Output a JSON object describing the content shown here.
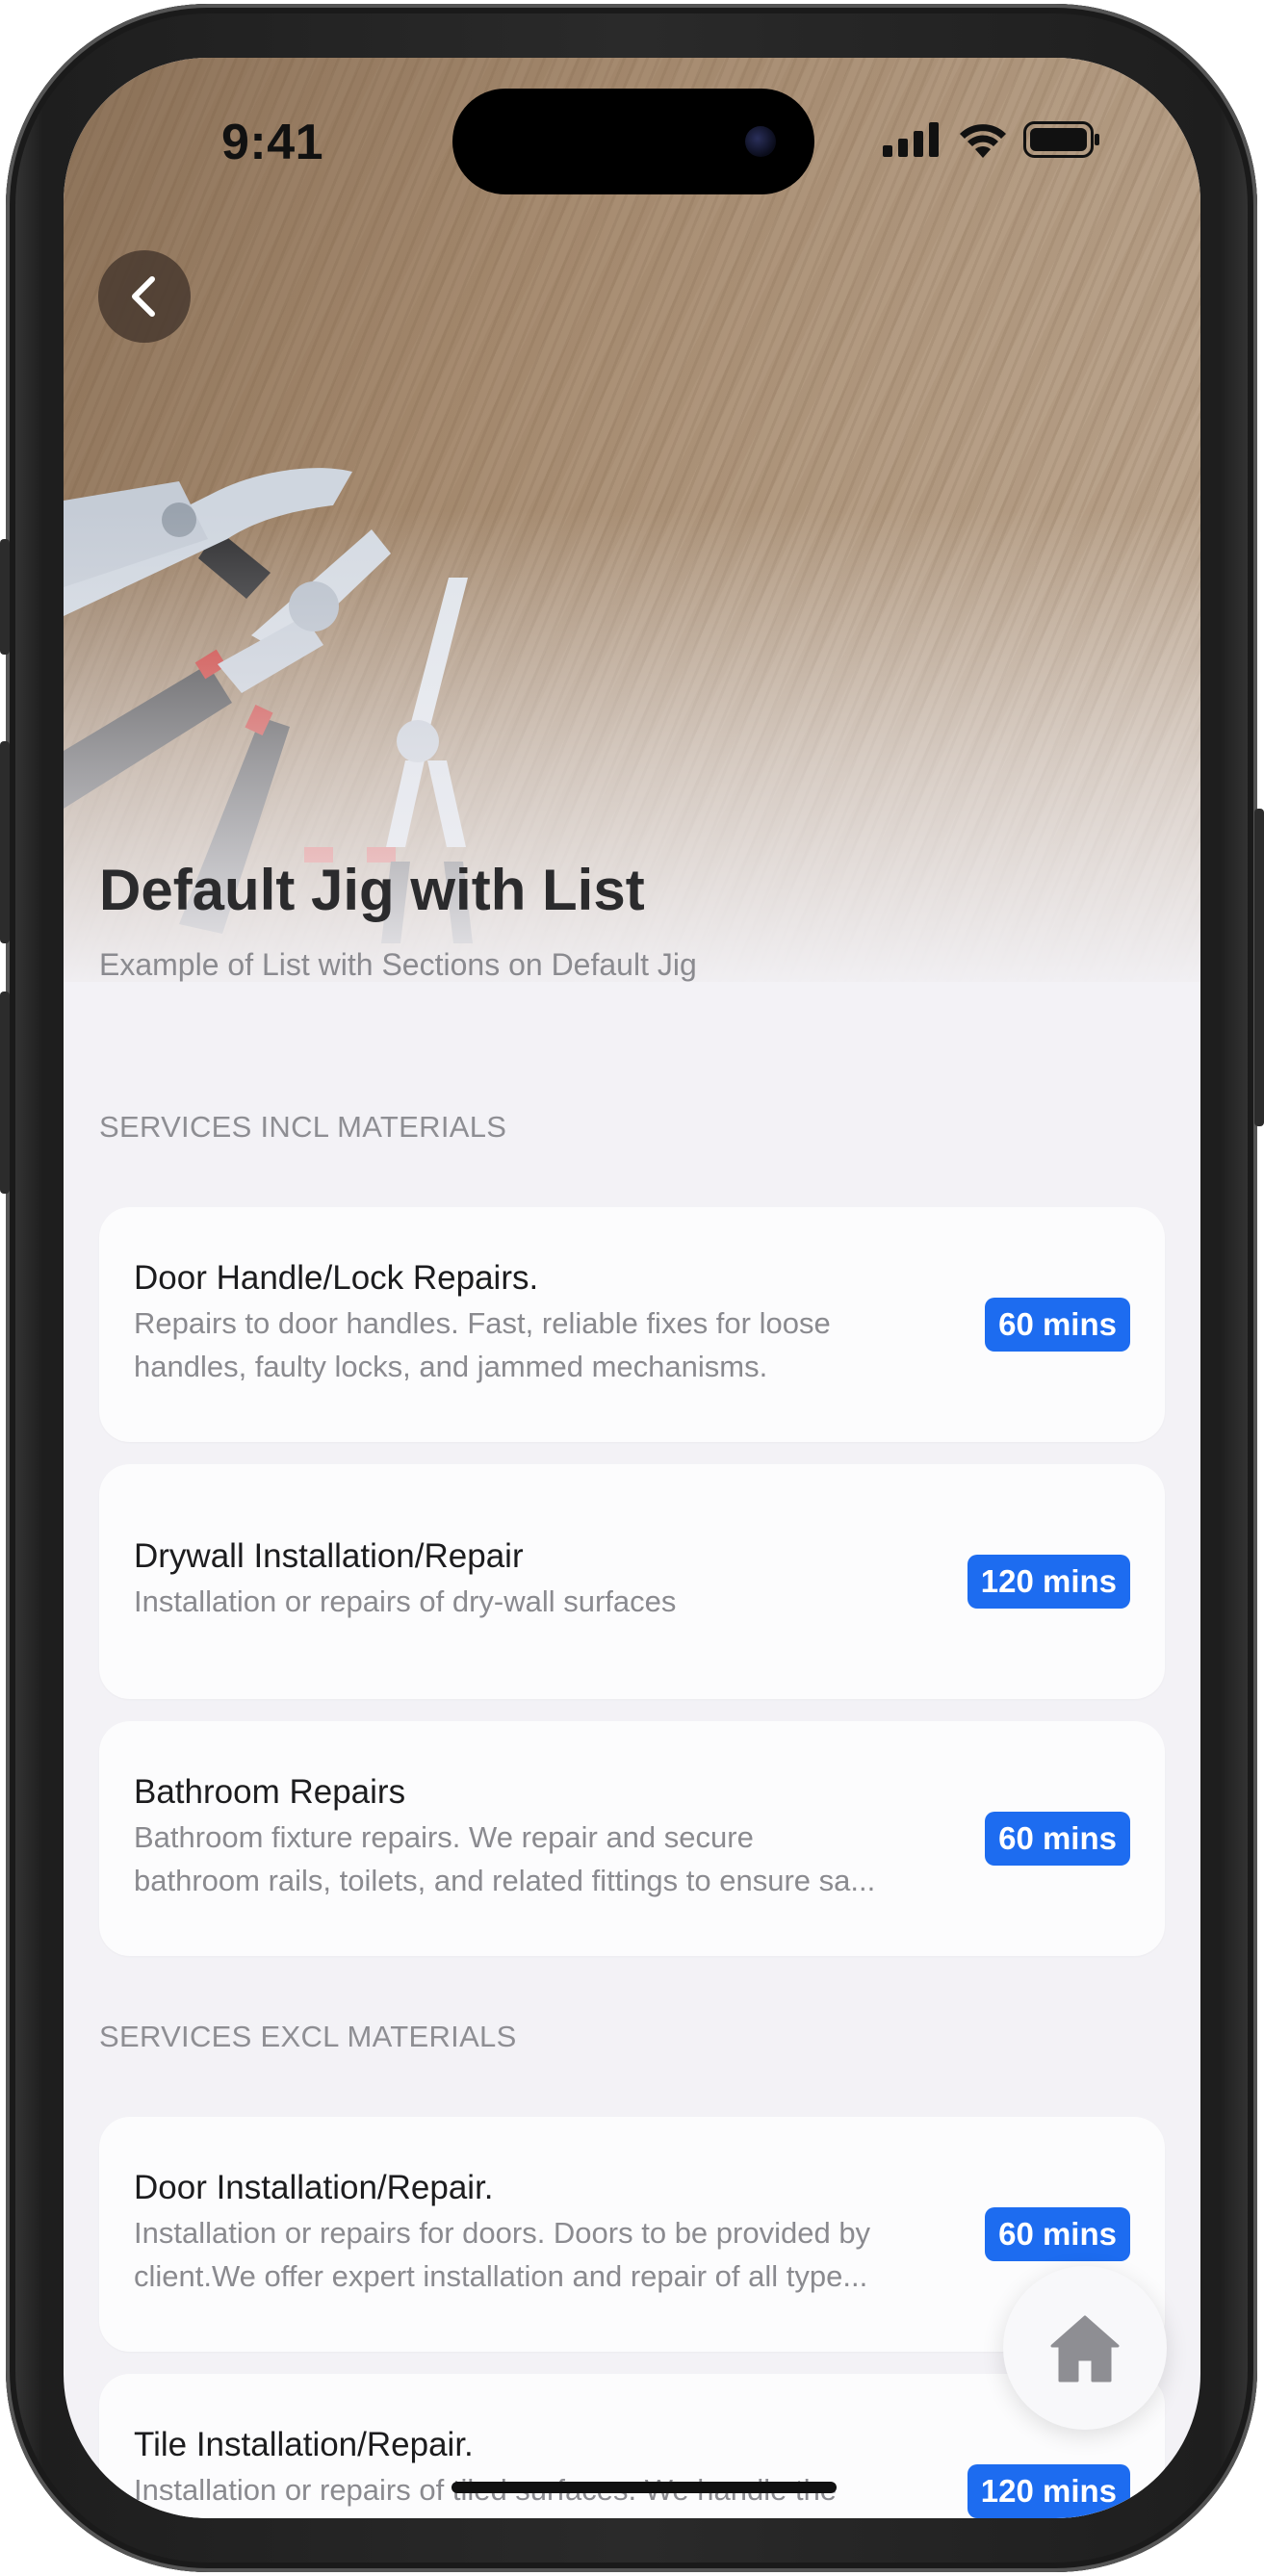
{
  "status_bar": {
    "time": "9:41",
    "icons": [
      "signal-icon",
      "wifi-icon",
      "battery-icon"
    ]
  },
  "navigation": {
    "back_icon": "chevron-left-icon"
  },
  "header": {
    "title": "Default Jig with List",
    "subtitle": "Example of List with Sections on Default Jig",
    "image": "pliers-on-wood-photo"
  },
  "sections": [
    {
      "title": "SERVICES INCL MATERIALS",
      "items": [
        {
          "title": "Door Handle/Lock Repairs.",
          "description": [
            "Repairs to door handles. Fast, reliable fixes for loose",
            "handles, faulty locks, and jammed mechanisms."
          ],
          "duration": "60 mins"
        },
        {
          "title": "Drywall Installation/Repair",
          "description": [
            "Installation or repairs of dry-wall surfaces"
          ],
          "duration": "120 mins"
        },
        {
          "title": "Bathroom Repairs",
          "description": [
            "Bathroom fixture repairs. We repair and secure",
            "bathroom rails, toilets, and related fittings to ensure sa..."
          ],
          "duration": "60 mins"
        }
      ]
    },
    {
      "title": "SERVICES EXCL MATERIALS",
      "items": [
        {
          "title": "Door Installation/Repair.",
          "description": [
            "Installation or repairs for doors. Doors to be provided by",
            "client.We offer expert installation and repair of all type..."
          ],
          "duration": "60 mins"
        },
        {
          "title": "Tile Installation/Repair.",
          "description": [
            "Installation or repairs of tiled surfaces.  We handle the"
          ],
          "duration": "120 mins"
        }
      ]
    }
  ],
  "fab": {
    "icon": "home-icon"
  },
  "colors": {
    "badge": "#1d6cf0",
    "background": "#f3f2f6",
    "card": "#fcfcfd",
    "title": "#2b2b2d",
    "secondary_text": "#8a8a8f"
  }
}
